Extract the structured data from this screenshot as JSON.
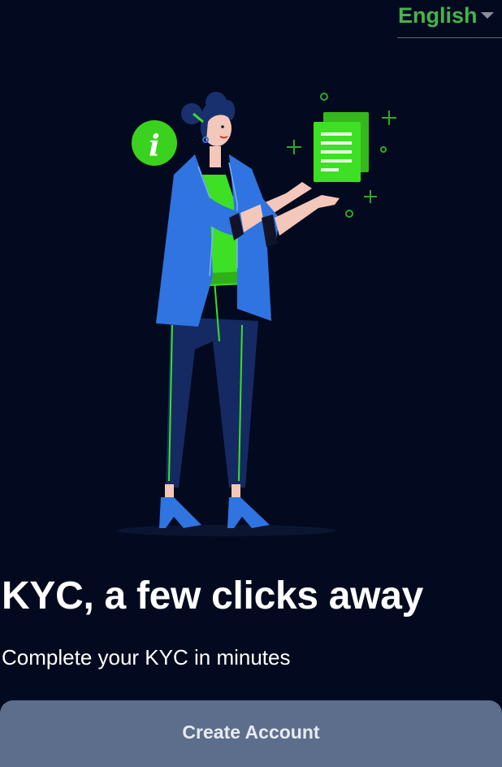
{
  "language_selector": {
    "value": "English",
    "icon": "caret-down-icon"
  },
  "hero": {
    "illustration": "woman-presenting-documents-illustration",
    "info_icon": "info-icon",
    "document_icon": "document-stack-icon"
  },
  "content": {
    "title": "KYC, a few clicks away",
    "subtitle": "Complete your KYC in minutes"
  },
  "actions": {
    "create_account_label": "Create Account"
  },
  "colors": {
    "background": "#030a1f",
    "accent_green": "#45b44d",
    "illustration_green": "#3de024",
    "jacket_blue": "#2f74e0",
    "button": "#5d6e8c"
  }
}
